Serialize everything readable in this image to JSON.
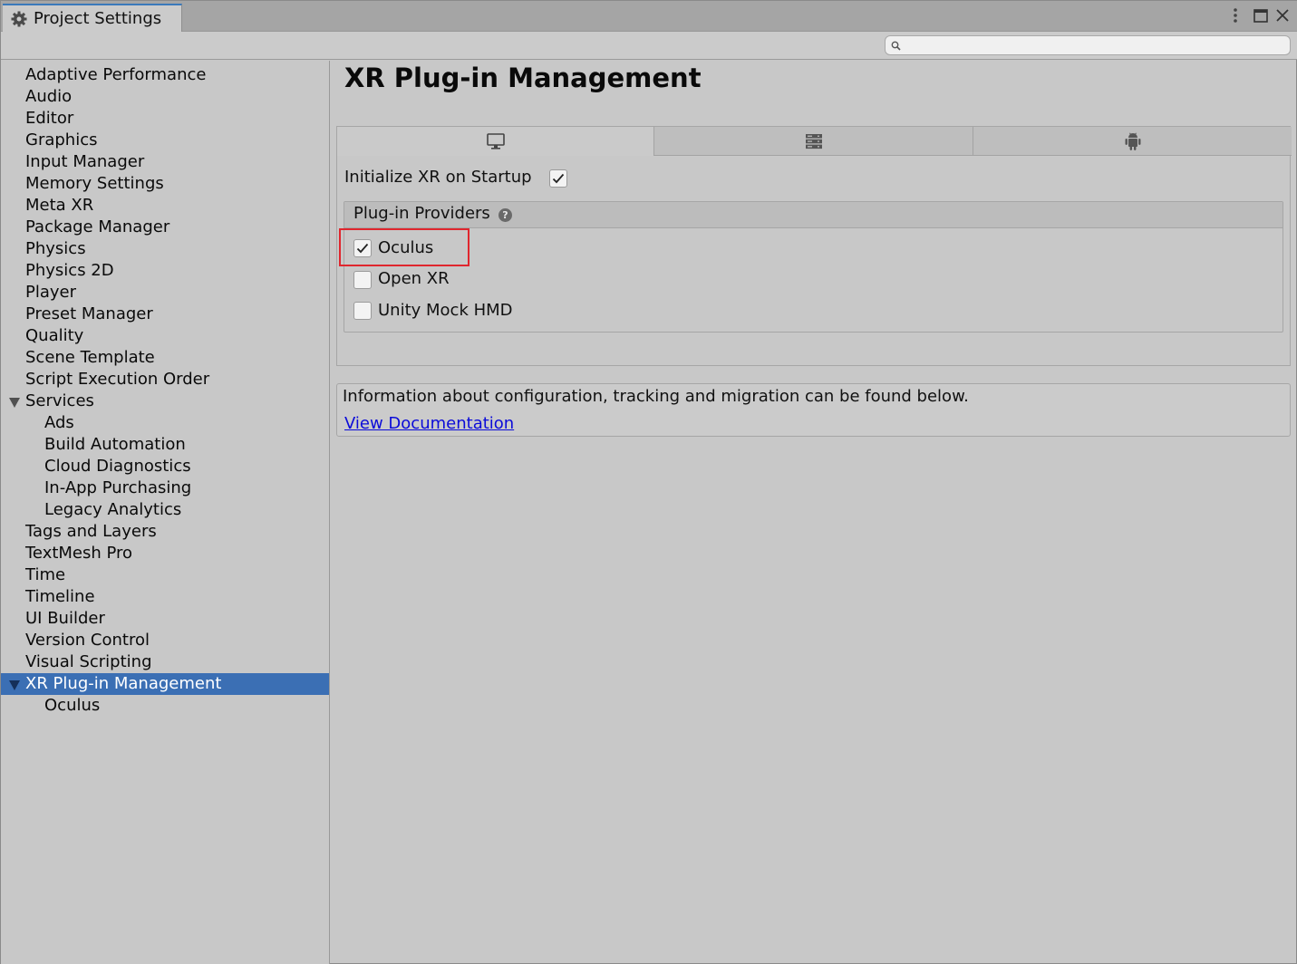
{
  "window": {
    "tab_title": "Project Settings",
    "tab_icon": "gear-icon",
    "controls": [
      "kebab-menu-icon",
      "maximize-icon",
      "close-icon"
    ]
  },
  "search": {
    "placeholder": "",
    "value": ""
  },
  "sidebar": {
    "items": [
      {
        "label": "Adaptive Performance"
      },
      {
        "label": "Audio"
      },
      {
        "label": "Editor"
      },
      {
        "label": "Graphics"
      },
      {
        "label": "Input Manager"
      },
      {
        "label": "Memory Settings"
      },
      {
        "label": "Meta XR"
      },
      {
        "label": "Package Manager"
      },
      {
        "label": "Physics"
      },
      {
        "label": "Physics 2D"
      },
      {
        "label": "Player"
      },
      {
        "label": "Preset Manager"
      },
      {
        "label": "Quality"
      },
      {
        "label": "Scene Template"
      },
      {
        "label": "Script Execution Order"
      },
      {
        "label": "Services"
      },
      {
        "label": "Ads"
      },
      {
        "label": "Build Automation"
      },
      {
        "label": "Cloud Diagnostics"
      },
      {
        "label": "In-App Purchasing"
      },
      {
        "label": "Legacy Analytics"
      },
      {
        "label": "Tags and Layers"
      },
      {
        "label": "TextMesh Pro"
      },
      {
        "label": "Time"
      },
      {
        "label": "Timeline"
      },
      {
        "label": "UI Builder"
      },
      {
        "label": "Version Control"
      },
      {
        "label": "Visual Scripting"
      },
      {
        "label": "XR Plug-in Management"
      },
      {
        "label": "Oculus"
      }
    ],
    "selected": "XR Plug-in Management"
  },
  "main": {
    "title": "XR Plug-in Management",
    "platform_tabs": [
      {
        "icon": "desktop-monitor-icon",
        "active": true
      },
      {
        "icon": "server-icon",
        "active": false
      },
      {
        "icon": "android-icon",
        "active": false
      }
    ],
    "init_on_startup": {
      "label": "Initialize XR on Startup",
      "checked": true
    },
    "providers": {
      "header": "Plug-in Providers",
      "help_icon": "help-icon",
      "items": [
        {
          "label": "Oculus",
          "checked": true
        },
        {
          "label": "Open XR",
          "checked": false
        },
        {
          "label": "Unity Mock HMD",
          "checked": false
        }
      ]
    },
    "info": {
      "text": "Information about configuration, tracking and migration can be found below.",
      "link": "View Documentation"
    },
    "highlight_color": "#e0262e",
    "selection_color": "#3b6fb4"
  }
}
